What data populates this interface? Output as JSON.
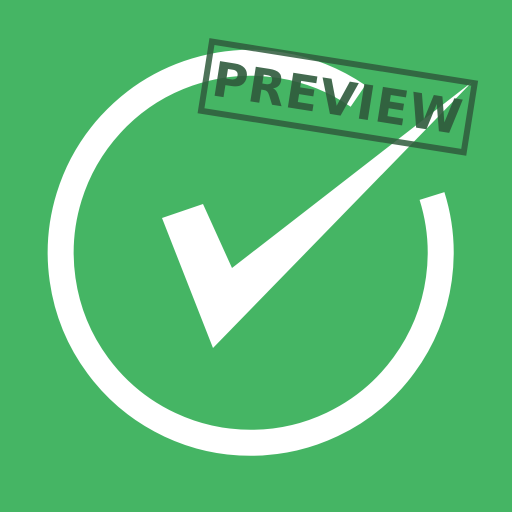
{
  "icon": {
    "name": "checkmark-circle-icon",
    "background_color": "#45b564",
    "foreground_color": "#ffffff"
  },
  "stamp": {
    "text": "PREVIEW",
    "color": "#2f5a3c"
  }
}
